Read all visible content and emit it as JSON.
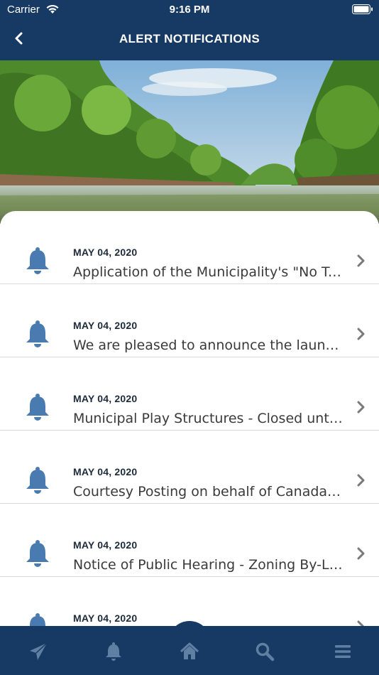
{
  "status": {
    "carrier": "Carrier",
    "time": "9:16 PM"
  },
  "nav": {
    "title": "ALERT NOTIFICATIONS"
  },
  "alerts": [
    {
      "date": "MAY 04, 2020",
      "text": "Application of the Municipality's \"No Truck Route\" By-Law"
    },
    {
      "date": "MAY 04, 2020",
      "text": "We are pleased to announce the launch of our new app"
    },
    {
      "date": "MAY 04, 2020",
      "text": "Municipal Play Structures - Closed until further notice"
    },
    {
      "date": "MAY 04, 2020",
      "text": "Courtesy Posting on behalf of Canada Post"
    },
    {
      "date": "MAY 04, 2020",
      "text": "Notice of Public Hearing - Zoning By-Law Amendment"
    },
    {
      "date": "MAY 04, 2020",
      "text": ""
    }
  ],
  "tabs": [
    "paper-plane-icon",
    "bell-icon",
    "home-icon",
    "search-icon",
    "menu-icon"
  ],
  "colors": {
    "nav": "#173a64",
    "icon": "#4a7bb0"
  }
}
